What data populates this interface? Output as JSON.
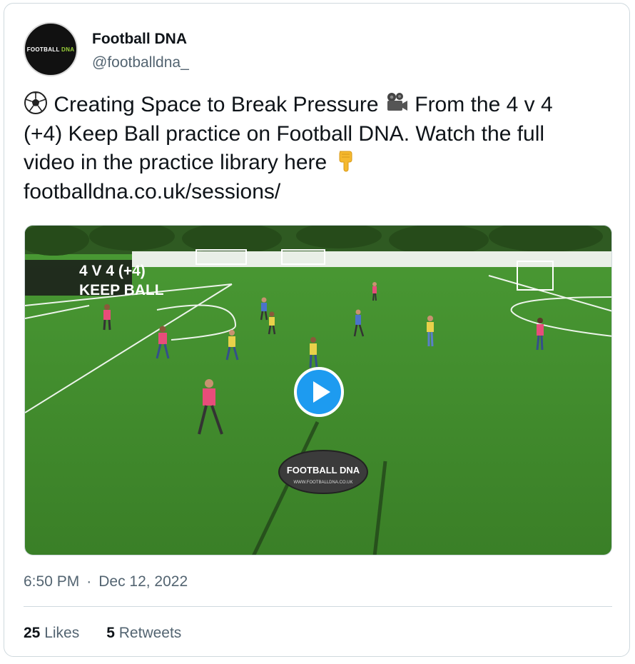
{
  "author": {
    "name": "Football DNA",
    "handle": "@footballdna_",
    "avatar_text_1": "FOOTBALL",
    "avatar_text_2": "DNA"
  },
  "tweet": {
    "part1": " Creating Space to Break Pressure ",
    "part2": " From the 4 v 4 (+4) Keep Ball practice on Football DNA. Watch the full video in the practice library here ",
    "link": "footballdna.co.uk/sessions/",
    "emoji_icons": [
      "soccer-ball-icon",
      "movie-camera-icon",
      "pointing-down-icon"
    ]
  },
  "video": {
    "overlay_line1": "4 V 4 (+4)",
    "overlay_line2": "KEEP BALL",
    "banner_text": "FOOTBALL DNA",
    "banner_subtext": "WWW.FOOTBALLDNA.CO.UK",
    "play_icon": "play-icon"
  },
  "meta": {
    "time": "6:50 PM",
    "separator": "·",
    "date": "Dec 12, 2022"
  },
  "stats": {
    "likes_count": "25",
    "likes_label": "Likes",
    "retweets_count": "5",
    "retweets_label": "Retweets"
  },
  "colors": {
    "accent": "#1d9bf0",
    "text": "#0f1419",
    "secondary": "#536471",
    "pitch": "#3f8a2a"
  }
}
